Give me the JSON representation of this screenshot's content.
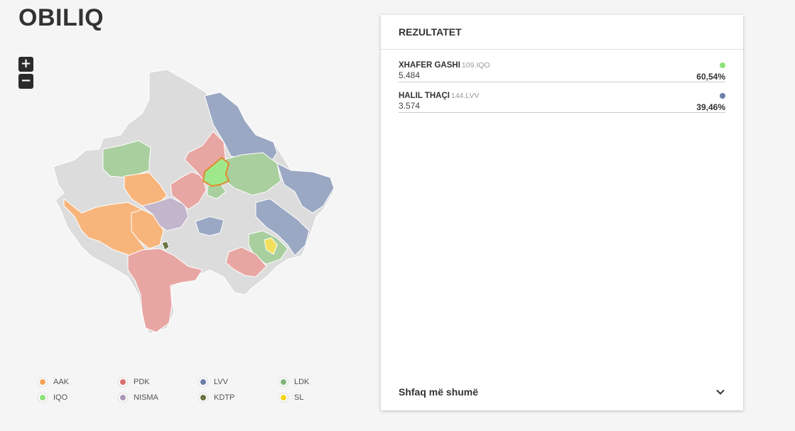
{
  "title": "OBILIQ",
  "zoom": {
    "in_label": "+",
    "out_label": "−"
  },
  "panel": {
    "header": "REZULTATET",
    "show_more": "Shfaq më shumë",
    "results": [
      {
        "name": "XHAFER GASHI",
        "code": "109.IQO",
        "votes": "5.484",
        "percent": "60,54%",
        "color": "#8ee27a"
      },
      {
        "name": "HALIL THAÇI",
        "code": "144.LVV",
        "votes": "3.574",
        "percent": "39,46%",
        "color": "#6b7fa8"
      }
    ]
  },
  "legend": [
    {
      "label": "AAK",
      "color": "#f4a259"
    },
    {
      "label": "PDK",
      "color": "#d9706c"
    },
    {
      "label": "LVV",
      "color": "#6b7fa8"
    },
    {
      "label": "LDK",
      "color": "#7fb57a"
    },
    {
      "label": "IQO",
      "color": "#8ee27a"
    },
    {
      "label": "NISMA",
      "color": "#a996b8"
    },
    {
      "label": "KDTP",
      "color": "#6b7545"
    },
    {
      "label": "SL",
      "color": "#f2d51a"
    }
  ],
  "map_colors": {
    "gray": "#dcdcdc",
    "aak": "#f7b57c",
    "pdk": "#e8a6a3",
    "lvv": "#9ba8c4",
    "ldk": "#a9cf9f",
    "iqo": "#9ee88a",
    "nisma": "#c2b6cc",
    "kdtp": "#6b7545",
    "sl": "#f2e05a",
    "highlight": "#e08a2a"
  }
}
